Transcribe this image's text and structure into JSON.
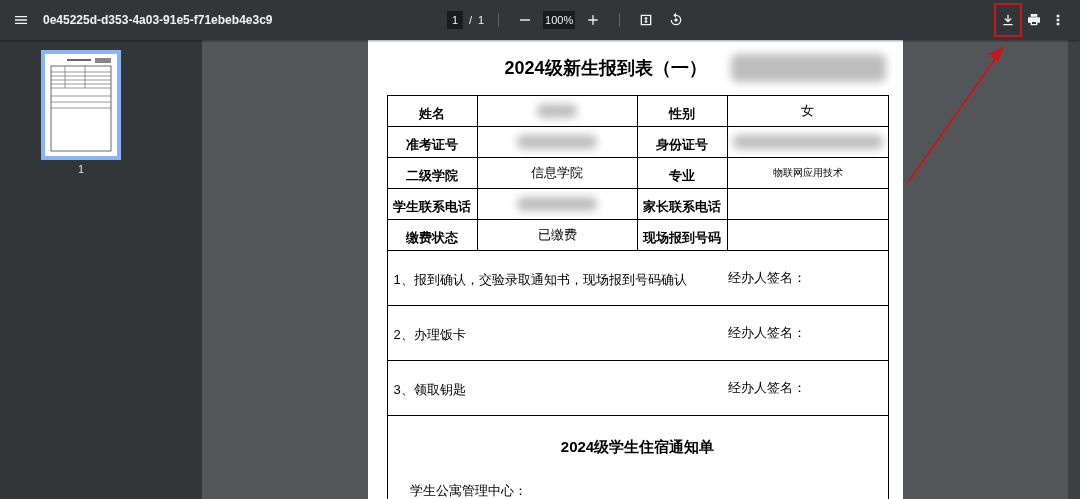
{
  "toolbar": {
    "title": "0e45225d-d353-4a03-91e5-f71ebeb4e3c9",
    "page_current": "1",
    "page_separator": "/",
    "page_total": "1",
    "zoom": "100%",
    "download_highlighted": true
  },
  "sidebar": {
    "thumbnails": [
      {
        "label": "1",
        "selected": true
      }
    ]
  },
  "document": {
    "title": "2024级新生报到表（一）",
    "title_redacted": true,
    "info_rows": [
      [
        {
          "kind": "label",
          "text": "姓名"
        },
        {
          "kind": "value",
          "redacted": true
        },
        {
          "kind": "label",
          "text": "性别"
        },
        {
          "kind": "value",
          "text": "女"
        }
      ],
      [
        {
          "kind": "label",
          "text": "准考证号"
        },
        {
          "kind": "value",
          "redacted": true
        },
        {
          "kind": "label",
          "text": "身份证号"
        },
        {
          "kind": "value",
          "redacted": true
        }
      ],
      [
        {
          "kind": "label",
          "text": "二级学院"
        },
        {
          "kind": "value",
          "text": "信息学院"
        },
        {
          "kind": "label",
          "text": "专业"
        },
        {
          "kind": "value",
          "text": "物联网应用技术",
          "compact": true
        }
      ],
      [
        {
          "kind": "label",
          "text": "学生联系电话"
        },
        {
          "kind": "value",
          "redacted": true
        },
        {
          "kind": "label",
          "text": "家长联系电话"
        },
        {
          "kind": "value"
        }
      ],
      [
        {
          "kind": "label",
          "text": "缴费状态"
        },
        {
          "kind": "value",
          "text": "已缴费"
        },
        {
          "kind": "label",
          "text": "现场报到号码"
        },
        {
          "kind": "value"
        }
      ]
    ],
    "steps": [
      {
        "text": "1、报到确认，交验录取通知书，现场报到号码确认",
        "signature_label": "经办人签名："
      },
      {
        "text": "2、办理饭卡",
        "signature_label": "经办人签名："
      },
      {
        "text": "3、领取钥匙",
        "signature_label": "经办人签名："
      }
    ],
    "section_title": "2024级学生住宿通知单",
    "section_text": "学生公寓管理中心："
  }
}
